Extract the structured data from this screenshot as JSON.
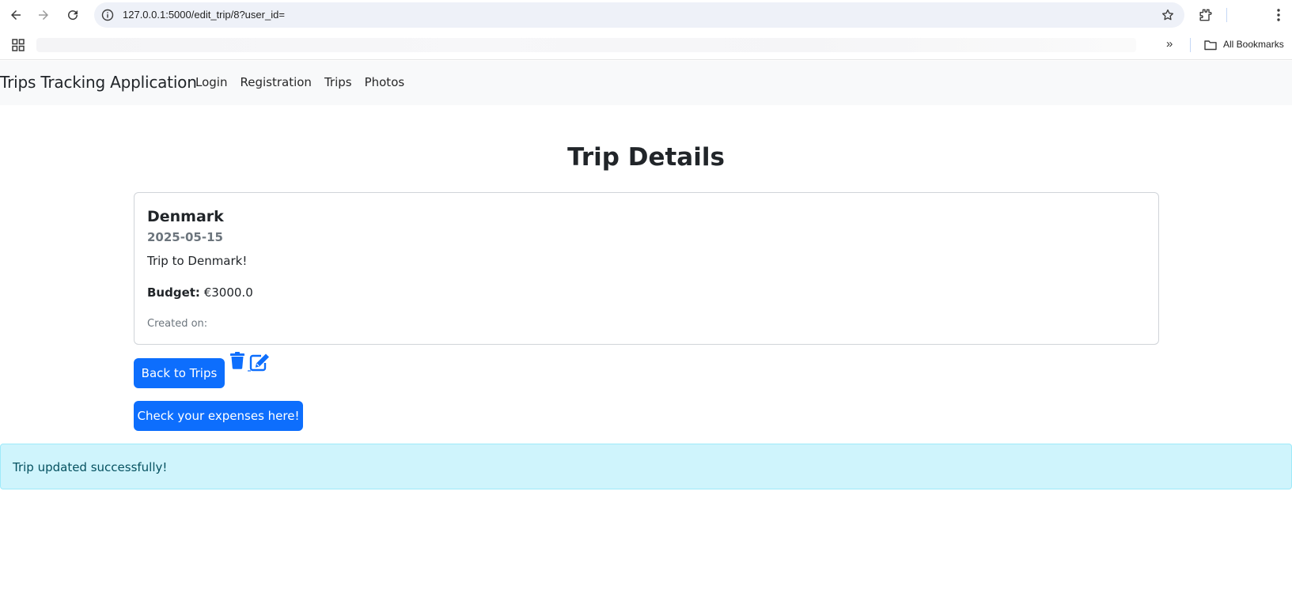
{
  "browser": {
    "url": "127.0.0.1:5000/edit_trip/8?user_id=",
    "all_bookmarks_label": "All Bookmarks",
    "icons": {
      "back": "back-arrow-icon",
      "forward": "forward-arrow-icon",
      "reload": "reload-icon",
      "site_info": "info-icon",
      "bookmark_star": "star-icon",
      "extensions": "puzzle-icon",
      "menu": "kebab-menu-icon",
      "apps": "apps-grid-icon",
      "more": "double-chevron-icon",
      "folder": "folder-icon"
    }
  },
  "navbar": {
    "brand": "Trips Tracking Application",
    "links": [
      "Login",
      "Registration",
      "Trips",
      "Photos"
    ]
  },
  "page": {
    "title": "Trip Details"
  },
  "trip": {
    "name": "Denmark",
    "date": "2025-05-15",
    "description": "Trip to Denmark!",
    "budget_label": "Budget:",
    "budget_value": "€3000.0",
    "created_on_label": "Created on:"
  },
  "actions": {
    "back_label": "Back to Trips",
    "expenses_label": "Check your expenses here!",
    "delete_icon": "trash-icon",
    "edit_icon": "edit-icon"
  },
  "alert": {
    "message": "Trip updated successfully!"
  },
  "colors": {
    "primary": "#0d6efd",
    "alert_bg": "#cff4fc",
    "alert_text": "#055160",
    "navbar_bg": "#f8f9fa"
  }
}
